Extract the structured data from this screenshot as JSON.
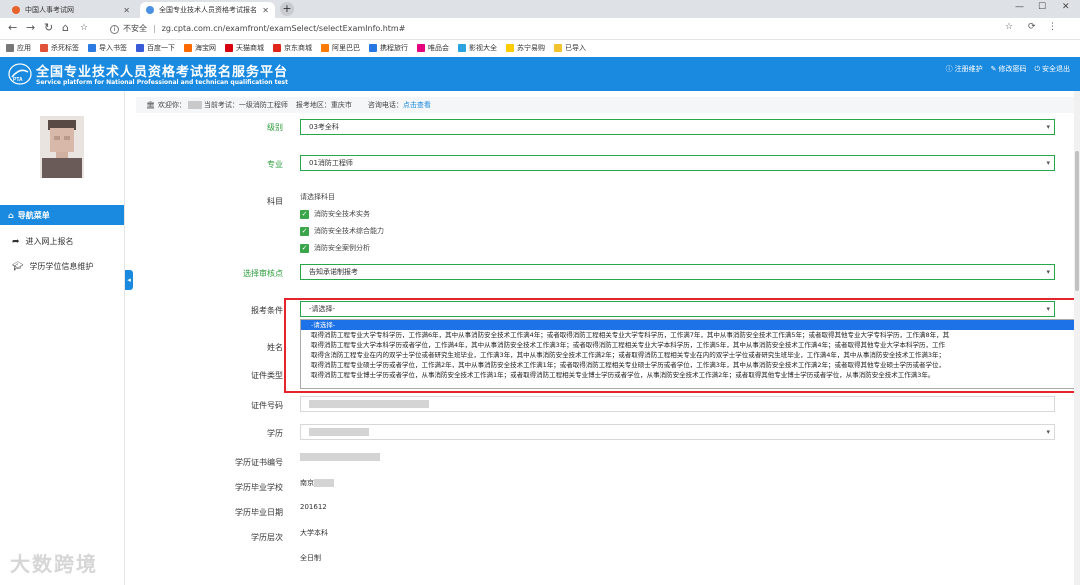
{
  "browser": {
    "tabs": [
      {
        "label": "中国人事考试网",
        "color": "#e8632a"
      },
      {
        "label": "全国专业技术人员资格考试报名",
        "color": "#4a90e2"
      }
    ],
    "security": "不安全",
    "url": "zg.cpta.com.cn/examfront/examSelect/selectExamInfo.htm#",
    "bookmarks": [
      {
        "label": "应用",
        "color": "#777777"
      },
      {
        "label": "杀死标签",
        "color": "#e0533a"
      },
      {
        "label": "导入书签",
        "color": "#2a7ae2"
      },
      {
        "label": "百度一下",
        "color": "#3a5bd9"
      },
      {
        "label": "海宝网",
        "color": "#ff6a00"
      },
      {
        "label": "天猫商城",
        "color": "#d7000f"
      },
      {
        "label": "京东商城",
        "color": "#e1251b"
      },
      {
        "label": "阿里巴巴",
        "color": "#ff7a00"
      },
      {
        "label": "携程旅行",
        "color": "#2577e3"
      },
      {
        "label": "唯品会",
        "color": "#e4007f"
      },
      {
        "label": "影视大全",
        "color": "#2aa4e0"
      },
      {
        "label": "苏宁易购",
        "color": "#ffcc00"
      },
      {
        "label": "已导入",
        "color": "#f2c230"
      }
    ]
  },
  "header": {
    "title": "全国专业技术人员资格考试报名服务平台",
    "subtitle": "Service platform for National Professional and technican qualification test",
    "links": [
      "注册维护",
      "修改密码",
      "安全退出"
    ]
  },
  "crumb": {
    "welcome": "欢迎你：",
    "exam_label": "当前考试：",
    "exam": "一级消防工程师",
    "region_label": "报考地区：",
    "region": "重庆市",
    "phone_label": "咨询电话：",
    "phone_link": "点击查看"
  },
  "sidebar": {
    "nav_head": "导航菜单",
    "items": [
      "进入网上报名",
      "学历学位信息维护"
    ]
  },
  "form": {
    "level_label": "级别",
    "level_value": "03考全科",
    "major_label": "专业",
    "major_value": "01消防工程师",
    "subject_label": "科目",
    "subject_hint": "请选择科目",
    "subjects": [
      "消防安全技术实务",
      "消防安全技术综合能力",
      "消防安全案例分析"
    ],
    "audit_label": "选择审核点",
    "audit_value": "告知承诺制报考",
    "condition_label": "报考条件",
    "condition_value": "-请选择-",
    "name_label": "姓名",
    "idtype_label": "证件类型",
    "idno_label": "证件号码",
    "edu_label": "学历",
    "cert_label": "学历证书编号",
    "school_label": "学历毕业学校",
    "school_value": "南京",
    "grad_date_label": "学历毕业日期",
    "grad_date_value": "201612",
    "edu_level_label": "学历层次",
    "edu_level_value": "大学本科",
    "study_form_value": "全日制"
  },
  "dropdown_options": [
    "-请选择-",
    "取得消防工程专业大学专科学历，工作满6年，其中从事消防安全技术工作满4年；或者取得消防工程相关专业大学专科学历，工作满7年，其中从事消防安全技术工作满5年；或者取得其他专业大学专科学历，工作满8年，其",
    "取得消防工程专业大学本科学历或者学位，工作满4年，其中从事消防安全技术工作满3年；或者取得消防工程相关专业大学本科学历，工作满5年，其中从事消防安全技术工作满4年；或者取得其他专业大学本科学历，工作",
    "取得含消防工程专业在内的双学士学位或者研究生班毕业，工作满3年，其中从事消防安全技术工作满2年；或者取得消防工程相关专业在内的双学士学位或者研究生班毕业，工作满4年，其中从事消防安全技术工作满3年；",
    "取得消防工程专业硕士学历或者学位，工作满2年，其中从事消防安全技术工作满1年；或者取得消防工程相关专业硕士学历或者学位，工作满3年，其中从事消防安全技术工作满2年；或者取得其他专业硕士学历或者学位，",
    "取得消防工程专业博士学历或者学位，从事消防安全技术工作满1年；或者取得消防工程相关专业博士学历或者学位，从事消防安全技术工作满2年；或者取得其他专业博士学历或者学位，从事消防安全技术工作满3年。"
  ],
  "watermark": "大数跨境"
}
